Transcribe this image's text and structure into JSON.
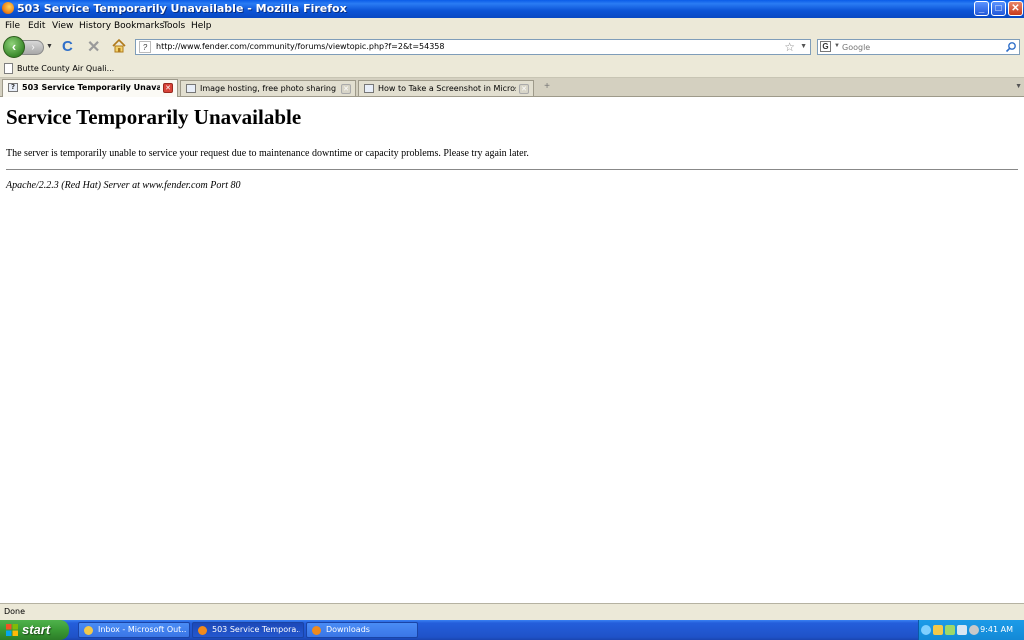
{
  "window": {
    "title": "503 Service Temporarily Unavailable - Mozilla Firefox",
    "minimize_glyph": "_",
    "maximize_glyph": "□",
    "close_glyph": "✕"
  },
  "menubar": {
    "items": [
      "File",
      "Edit",
      "View",
      "History",
      "Bookmarks",
      "Tools",
      "Help"
    ]
  },
  "navbar": {
    "back_glyph": "‹",
    "forward_glyph": "›",
    "reload_glyph": "C",
    "stop_glyph": "✕",
    "url": "http://www.fender.com/community/forums/viewtopic.php?f=2&t=54358",
    "search_engine_glyph": "G",
    "search_placeholder": "Google"
  },
  "bookmarks": {
    "items": [
      {
        "label": "Butte County Air Quali..."
      }
    ]
  },
  "tabs": [
    {
      "label": "503 Service Temporarily Unavail...",
      "active": true
    },
    {
      "label": "Image hosting, free photo sharing & vi...",
      "active": false
    },
    {
      "label": "How to Take a Screenshot in Microsoft ...",
      "active": false
    }
  ],
  "newtab_glyph": "+",
  "page": {
    "title": "Service Temporarily Unavailable",
    "message": "The server is temporarily unable to service your request due to maintenance downtime or capacity problems. Please try again later.",
    "address": "Apache/2.2.3 (Red Hat) Server at www.fender.com Port 80"
  },
  "statusbar": {
    "text": "Done"
  },
  "taskbar": {
    "start_label": "start",
    "tasks": [
      {
        "label": "Inbox - Microsoft Out...",
        "icon": "outlook-icon",
        "active": false
      },
      {
        "label": "503 Service Tempora...",
        "icon": "firefox-icon",
        "active": true
      },
      {
        "label": "Downloads",
        "icon": "firefox-icon",
        "active": false
      }
    ],
    "clock": "9:41 AM"
  },
  "colors": {
    "titlebar": "#0b53d6",
    "chrome": "#ece9d8",
    "taskbar": "#245edb",
    "start": "#3a9a35",
    "tray": "#1389d6"
  }
}
